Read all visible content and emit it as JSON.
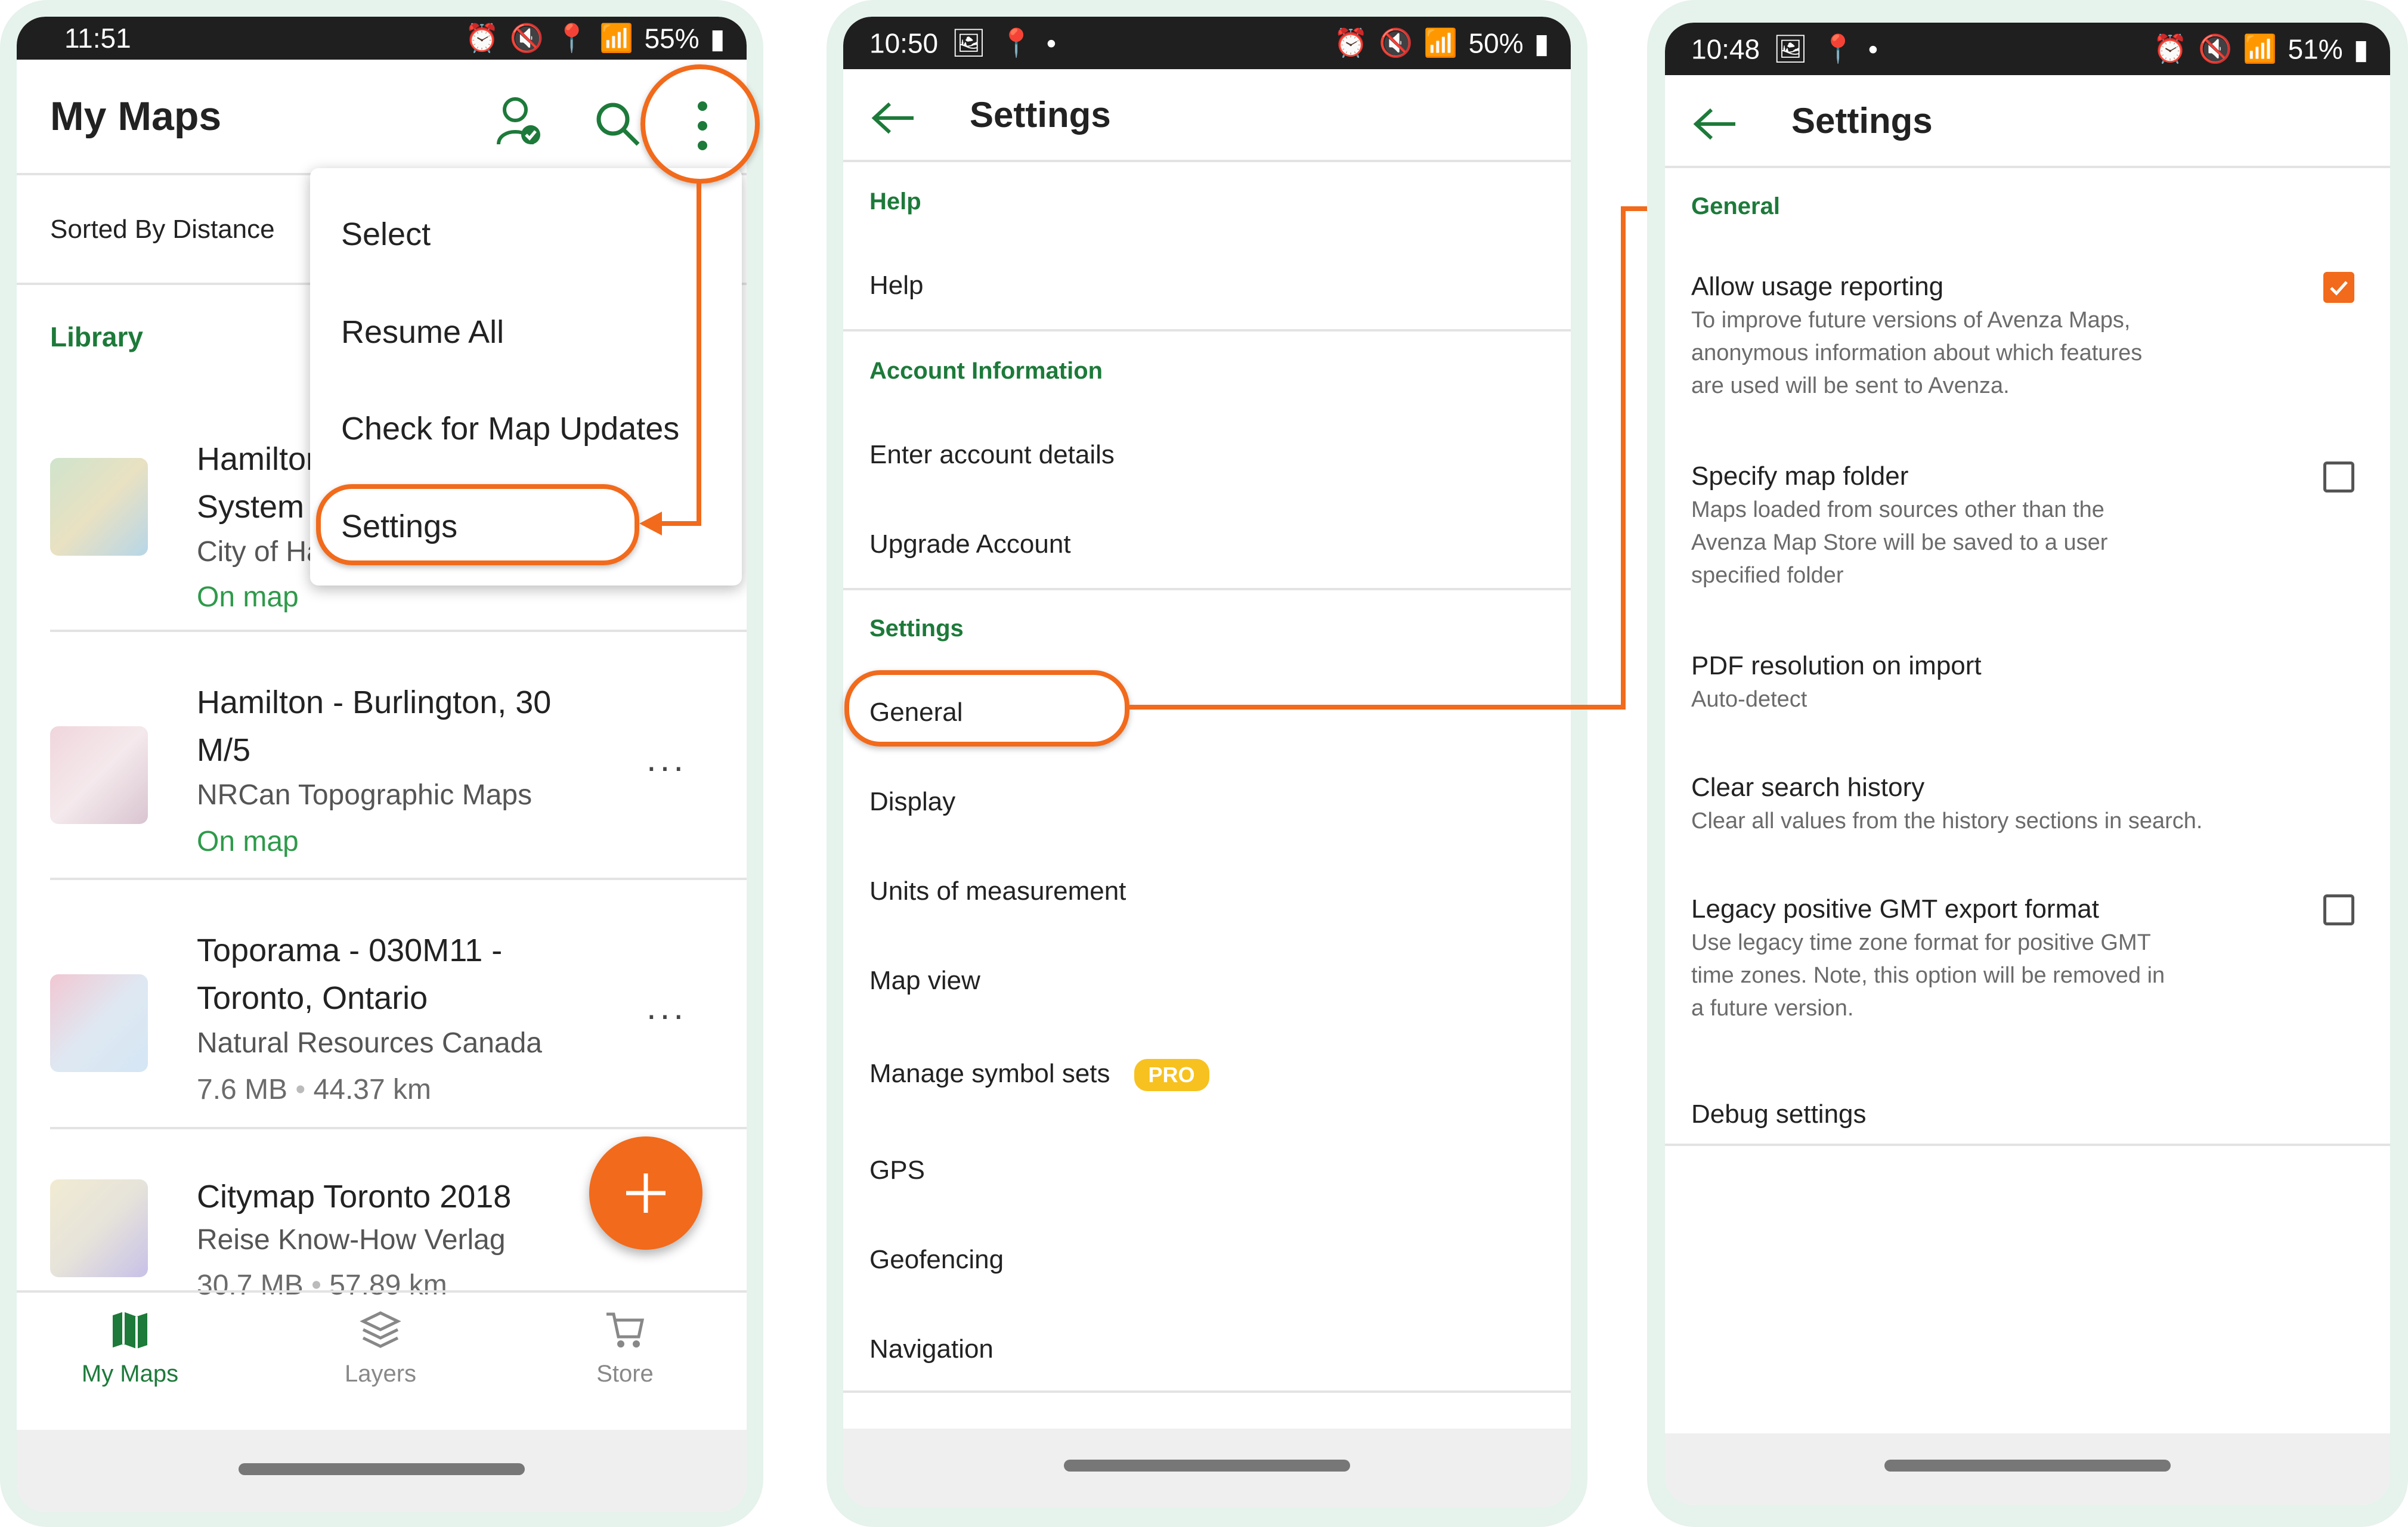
{
  "phone1": {
    "status": {
      "time": "11:51",
      "battery": "55%"
    },
    "header": {
      "title": "My Maps"
    },
    "sort_label": "Sorted By Distance",
    "section_library": "Library",
    "menu": {
      "items": [
        "Select",
        "Resume All",
        "Check for Map Updates",
        "Settings"
      ]
    },
    "maps": [
      {
        "title_line1": "Hamilton",
        "title_line2": "System",
        "publisher": "City of Ha",
        "status": "On map"
      },
      {
        "title_line1": "Hamilton - Burlington, 30",
        "title_line2": "M/5",
        "publisher": "NRCan Topographic Maps",
        "status": "On map"
      },
      {
        "title_line1": "Toporama - 030M11 -",
        "title_line2": "Toronto, Ontario",
        "publisher": "Natural Resources Canada",
        "size": "7.6 MB",
        "distance": "44.37 km"
      },
      {
        "title_line1": "Citymap Toronto 2018",
        "publisher": "Reise Know-How Verlag",
        "size": "30.7 MB",
        "distance": "57.89 km"
      }
    ],
    "more_label": "...",
    "fab_label": "+",
    "tabs": [
      {
        "label": "My Maps",
        "icon": "map-icon"
      },
      {
        "label": "Layers",
        "icon": "layers-icon"
      },
      {
        "label": "Store",
        "icon": "cart-icon"
      }
    ]
  },
  "phone2": {
    "status": {
      "time": "10:50",
      "battery": "50%"
    },
    "header": {
      "title": "Settings"
    },
    "sections": {
      "help": "Help",
      "account": "Account Information",
      "settings": "Settings"
    },
    "items": {
      "help": "Help",
      "enter_account": "Enter account details",
      "upgrade": "Upgrade Account",
      "general": "General",
      "display": "Display",
      "units": "Units of measurement",
      "map_view": "Map view",
      "symbol_sets": "Manage symbol sets",
      "pro_badge": "PRO",
      "gps": "GPS",
      "geofencing": "Geofencing",
      "navigation": "Navigation"
    }
  },
  "phone3": {
    "status": {
      "time": "10:48",
      "battery": "51%"
    },
    "header": {
      "title": "Settings"
    },
    "section_general": "General",
    "options": [
      {
        "title": "Allow usage reporting",
        "desc_lines": [
          "To improve future versions of Avenza Maps,",
          "anonymous information about which features",
          "are used will be sent to Avenza."
        ],
        "checked": true
      },
      {
        "title": "Specify map folder",
        "desc_lines": [
          "Maps loaded from sources other than the",
          "Avenza Map Store will be saved to a user",
          "specified folder"
        ],
        "checked": false
      },
      {
        "title": "PDF resolution on import",
        "desc_lines": [
          "Auto-detect"
        ]
      },
      {
        "title": "Clear search history",
        "desc_lines": [
          "Clear all values from the history sections in search."
        ]
      },
      {
        "title": "Legacy positive GMT export format",
        "desc_lines": [
          "Use legacy time zone format for positive GMT",
          "time zones. Note, this option will be removed in",
          "a future version."
        ],
        "checked": false
      },
      {
        "title": "Debug settings",
        "desc_lines": []
      }
    ]
  },
  "colors": {
    "accent": "#f26a1b",
    "brand_green": "#1d7a3a",
    "pro_yellow": "#f7c21f"
  }
}
